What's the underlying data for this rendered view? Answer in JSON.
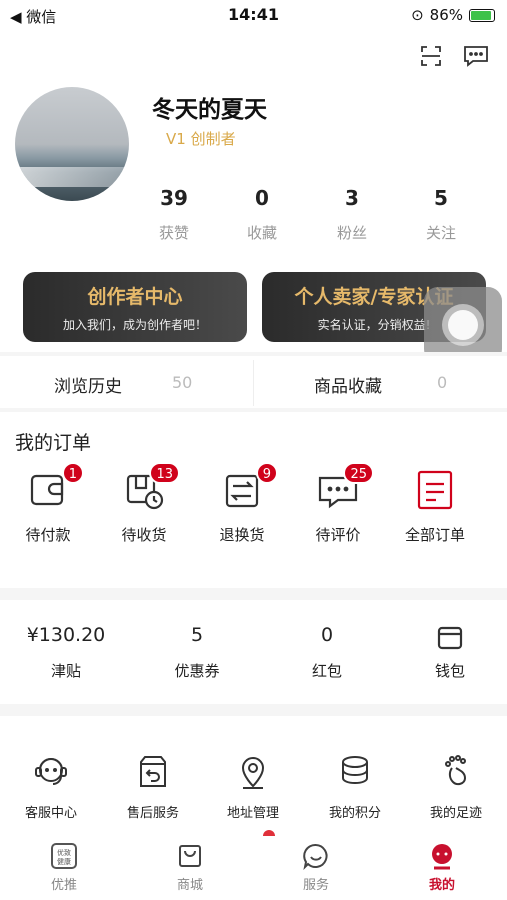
{
  "status_bar": {
    "carrier": "◀ 微信",
    "time": "14:41",
    "battery": "86%",
    "battery_level": 0.86
  },
  "profile": {
    "name": "冬天的夏天",
    "level": "V1 创制者"
  },
  "stats": [
    {
      "num": "39",
      "label": "获赞"
    },
    {
      "num": "0",
      "label": "收藏"
    },
    {
      "num": "3",
      "label": "粉丝"
    },
    {
      "num": "5",
      "label": "关注"
    }
  ],
  "banners": [
    {
      "title": "创作者中心",
      "subtitle": "加入我们，成为创作者吧！"
    },
    {
      "title": "个人卖家/专家认证",
      "subtitle": "实名认证，分销权益!"
    }
  ],
  "history": {
    "browse_label": "浏览历史",
    "browse_count": "50",
    "fav_label": "商品收藏",
    "fav_count": "0"
  },
  "orders": {
    "title": "我的订单",
    "items": [
      {
        "label": "待付款",
        "badge": "1",
        "icon": "wallet-icon"
      },
      {
        "label": "待收货",
        "badge": "13",
        "icon": "delivery-icon"
      },
      {
        "label": "退换货",
        "badge": "9",
        "icon": "exchange-icon"
      },
      {
        "label": "待评价",
        "badge": "25",
        "icon": "comment-icon"
      },
      {
        "label": "全部订单",
        "badge": "",
        "icon": "order-list-icon"
      }
    ]
  },
  "wallet": [
    {
      "value": "¥130.20",
      "label": "津贴"
    },
    {
      "value": "5",
      "label": "优惠券"
    },
    {
      "value": "0",
      "label": "红包"
    },
    {
      "value": "",
      "label": "钱包"
    }
  ],
  "services": [
    {
      "label": "客服中心",
      "icon": "customer-service-icon"
    },
    {
      "label": "售后服务",
      "icon": "after-sale-icon"
    },
    {
      "label": "地址管理",
      "icon": "location-icon"
    },
    {
      "label": "我的积分",
      "icon": "points-icon"
    },
    {
      "label": "我的足迹",
      "icon": "footprint-icon"
    }
  ],
  "tabbar": [
    {
      "label": "优推",
      "icon_text": "优致\n健康"
    },
    {
      "label": "商城"
    },
    {
      "label": "服务"
    },
    {
      "label": "我的"
    }
  ],
  "colors": {
    "accent": "#c8102e",
    "gold": "#e6b96a",
    "badge": "#d0021b"
  }
}
